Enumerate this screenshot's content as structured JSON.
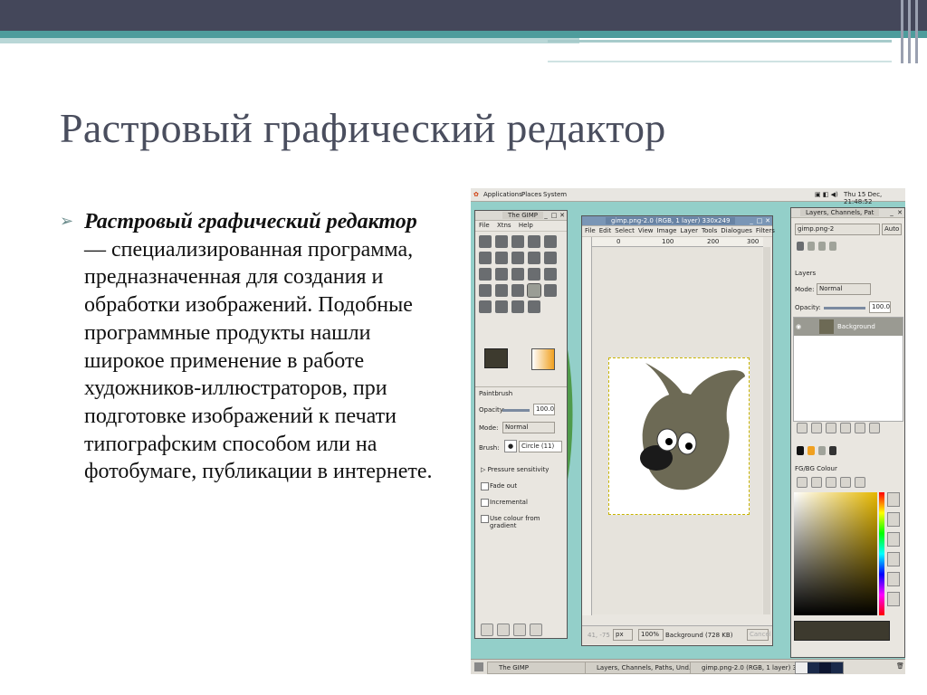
{
  "slide": {
    "title": "Растровый графический редактор",
    "bullet_term": "Растровый графический редактор",
    "bullet_dash": " — ",
    "bullet_text": "специализированная программа, предназначенная для создания и обработки изображений. Подобные программные продукты нашли широкое применение в работе художников-иллюстраторов, при подготовке изображений к печати типографским способом или на фотобумаге, публикации в интернете."
  },
  "screenshot": {
    "top_panel": {
      "applications": "Applications",
      "places": "Places",
      "system": "System",
      "clock": "Thu 15 Dec, 21:48:52"
    },
    "toolbox": {
      "title": "The GIMP",
      "menu": [
        "File",
        "Xtns",
        "Help"
      ],
      "tool_options": {
        "title": "Paintbrush",
        "opacity_label": "Opacity:",
        "opacity_value": "100.0",
        "mode_label": "Mode:",
        "mode_value": "Normal",
        "brush_label": "Brush:",
        "brush_value": "Circle (11)",
        "pressure": "Pressure sensitivity",
        "fade_out": "Fade out",
        "incremental": "Incremental",
        "use_gradient": "Use colour from gradient"
      }
    },
    "image_window": {
      "title": "gimp.png-2.0 (RGB, 1 layer) 330x249",
      "menu": [
        "File",
        "Edit",
        "Select",
        "View",
        "Image",
        "Layer",
        "Tools",
        "Dialogues",
        "Filters"
      ],
      "ruler_labels": [
        "0",
        "100",
        "200",
        "300"
      ],
      "coords": "41, -75",
      "unit": "px",
      "zoom": "100%",
      "status": "Background (728 KB)",
      "cancel": "Cancel"
    },
    "layers_dock": {
      "title": "Layers, Channels, Pat",
      "image_select": "gimp.png-2",
      "auto": "Auto",
      "layers_title": "Layers",
      "mode_label": "Mode:",
      "mode_value": "Normal",
      "opacity_label": "Opacity:",
      "opacity_value": "100.0",
      "layer_name": "Background",
      "fgbg_title": "FG/BG Colour"
    },
    "taskbar": [
      "The GIMP",
      "Layers, Channels, Paths, Und...",
      "gimp.png-2.0 (RGB, 1 layer) 3..."
    ],
    "colors": {
      "desktop": "#93cfc9",
      "fg_color": "#3d3a2e",
      "bg_color": "#ffffff",
      "accent_orange": "#f0a020"
    }
  }
}
